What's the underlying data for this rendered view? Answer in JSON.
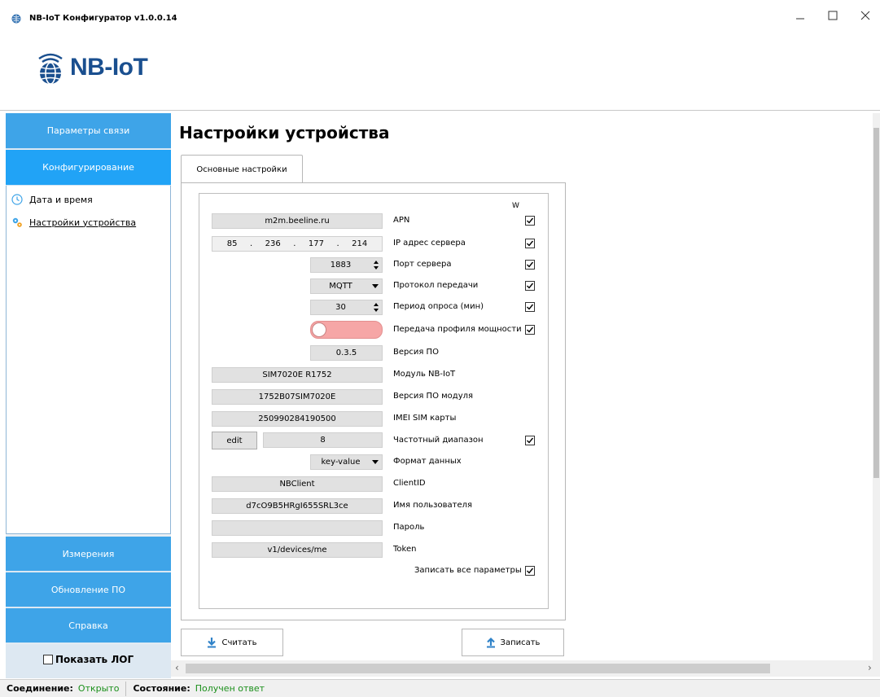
{
  "window": {
    "title": "NB-IoT Конфигуратор v1.0.0.14"
  },
  "logo": {
    "text": "NB-IoT"
  },
  "sidebar": {
    "nav": [
      {
        "label": "Параметры связи"
      },
      {
        "label": "Конфигурирование"
      }
    ],
    "sub_items": [
      {
        "label": "Дата и время",
        "icon": "clock-icon"
      },
      {
        "label": "Настройки устройства",
        "icon": "gears-icon"
      }
    ],
    "bottom_nav": [
      {
        "label": "Измерения"
      },
      {
        "label": "Обновление ПО"
      },
      {
        "label": "Справка"
      }
    ],
    "show_log_label": "Показать ЛОГ"
  },
  "main": {
    "page_title": "Настройки устройства",
    "tab_label": "Основные настройки",
    "w_header": "W",
    "fields": {
      "apn": {
        "value": "m2m.beeline.ru",
        "label": "APN",
        "write": true
      },
      "ip": {
        "octets": [
          "85",
          "236",
          "177",
          "214"
        ],
        "label": "IP адрес сервера",
        "write": true
      },
      "port": {
        "value": "1883",
        "label": "Порт сервера",
        "write": true
      },
      "protocol": {
        "value": "MQTT",
        "label": "Протокол передачи",
        "write": true
      },
      "poll_period": {
        "value": "30",
        "label": "Период опроса (мин)",
        "write": true
      },
      "power_profile": {
        "label": "Передача профиля мощности",
        "enabled": false,
        "write": true
      },
      "fw_version": {
        "value": "0.3.5",
        "label": "Версия ПО"
      },
      "module": {
        "value": "SIM7020E R1752",
        "label": "Модуль NB-IoT"
      },
      "module_fw": {
        "value": "1752B07SIM7020E",
        "label": "Версия ПО модуля"
      },
      "imei_sim": {
        "value": "250990284190500",
        "label": "IMEI SIM карты"
      },
      "band": {
        "edit_label": "edit",
        "value": "8",
        "label": "Частотный диапазон",
        "write": true
      },
      "data_format": {
        "value": "key-value",
        "label": "Формат данных"
      },
      "client_id": {
        "value": "NBClient",
        "label": "ClientID"
      },
      "username": {
        "value": "d7cO9B5HRgI655SRL3ce",
        "label": "Имя пользователя"
      },
      "password": {
        "value": "",
        "label": "Пароль"
      },
      "token": {
        "value": "v1/devices/me",
        "label": "Token"
      }
    },
    "write_all_label": "Записать все параметры",
    "write_all_checked": true,
    "read_button": "Считать",
    "write_button": "Записать"
  },
  "statusbar": {
    "connection_key": "Соединение:",
    "connection_value": "Открыто",
    "state_key": "Состояние:",
    "state_value": "Получен ответ"
  },
  "colors": {
    "nav_blue": "#3ea4e8",
    "nav_active": "#21a3f6",
    "status_green": "#1a8f1a",
    "toggle_off": "#f6a6a6",
    "logo_blue": "#1a4f8f"
  }
}
